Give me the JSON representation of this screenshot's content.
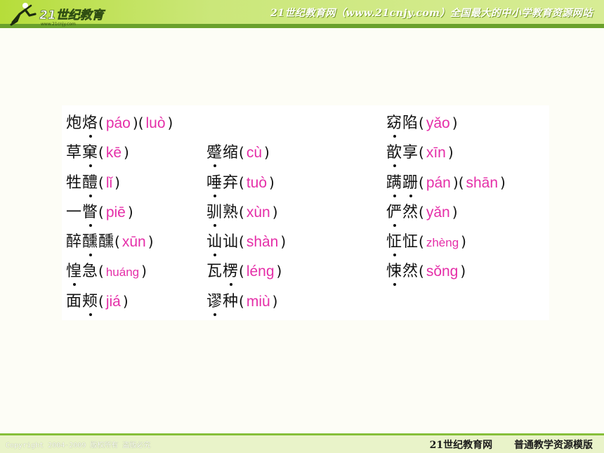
{
  "header": {
    "logo_text": "21世纪教育",
    "logo_url_text": "www.21cnjy.com",
    "site_title": "21世纪教育网（www.21cnjy.com）全国最大的中小学教育资源网站"
  },
  "columns": [
    [
      {
        "word": "炮烙",
        "parts": [
          "páo",
          "luò"
        ],
        "dots": [
          1
        ]
      },
      {
        "word": "草窠",
        "parts": [
          "kē"
        ],
        "dots": [
          1
        ]
      },
      {
        "word": "牲醴",
        "parts": [
          "lǐ"
        ],
        "dots": [
          1
        ]
      },
      {
        "word": "一瞥",
        "parts": [
          "piē"
        ],
        "dots": [
          1
        ]
      },
      {
        "word": "醉醺醺",
        "parts": [
          "xūn"
        ],
        "dots": [
          1
        ]
      },
      {
        "word": "惶急",
        "parts": [
          "huáng"
        ],
        "dots": [
          0
        ]
      },
      {
        "word": "面颊",
        "parts": [
          "jiá"
        ],
        "dots": [
          1
        ]
      }
    ],
    [
      {
        "word": "蹙缩",
        "parts": [
          "cù"
        ],
        "dots": [
          0
        ]
      },
      {
        "word": "唾弃",
        "parts": [
          "tuò"
        ],
        "dots": [
          0
        ]
      },
      {
        "word": "驯熟",
        "parts": [
          "xùn"
        ],
        "dots": [
          0
        ]
      },
      {
        "word": "讪讪",
        "parts": [
          "shàn"
        ],
        "dots": [
          0
        ]
      },
      {
        "word": "瓦楞",
        "parts": [
          "léng"
        ],
        "dots": [
          1
        ]
      },
      {
        "word": "谬种",
        "parts": [
          "miù"
        ],
        "dots": [
          0
        ]
      }
    ],
    [
      {
        "word": "窈陷",
        "parts": [
          "yǎo"
        ],
        "dots": [
          0
        ]
      },
      {
        "word": "歆享",
        "parts": [
          "xīn"
        ],
        "dots": [
          0
        ]
      },
      {
        "word": "蹒跚",
        "parts": [
          "pán",
          "shān"
        ],
        "dots": [
          0,
          1
        ]
      },
      {
        "word": "俨然",
        "parts": [
          "yǎn"
        ],
        "dots": [
          0
        ]
      },
      {
        "word": "怔怔",
        "parts": [
          "zhèng"
        ],
        "dots": [
          0
        ]
      },
      {
        "word": "悚然",
        "parts": [
          "sǒng"
        ],
        "dots": [
          0
        ]
      }
    ]
  ],
  "footer": {
    "copyright": "Copyright 2004-2009 版权所有 盗版必究",
    "site_name": "21世纪教育网",
    "template_name": "普通教学资源模版"
  },
  "colors": {
    "header_green": "#b6dd3a",
    "pinyin_magenta": "#e52fa8",
    "footer_green": "#86bf3a"
  }
}
